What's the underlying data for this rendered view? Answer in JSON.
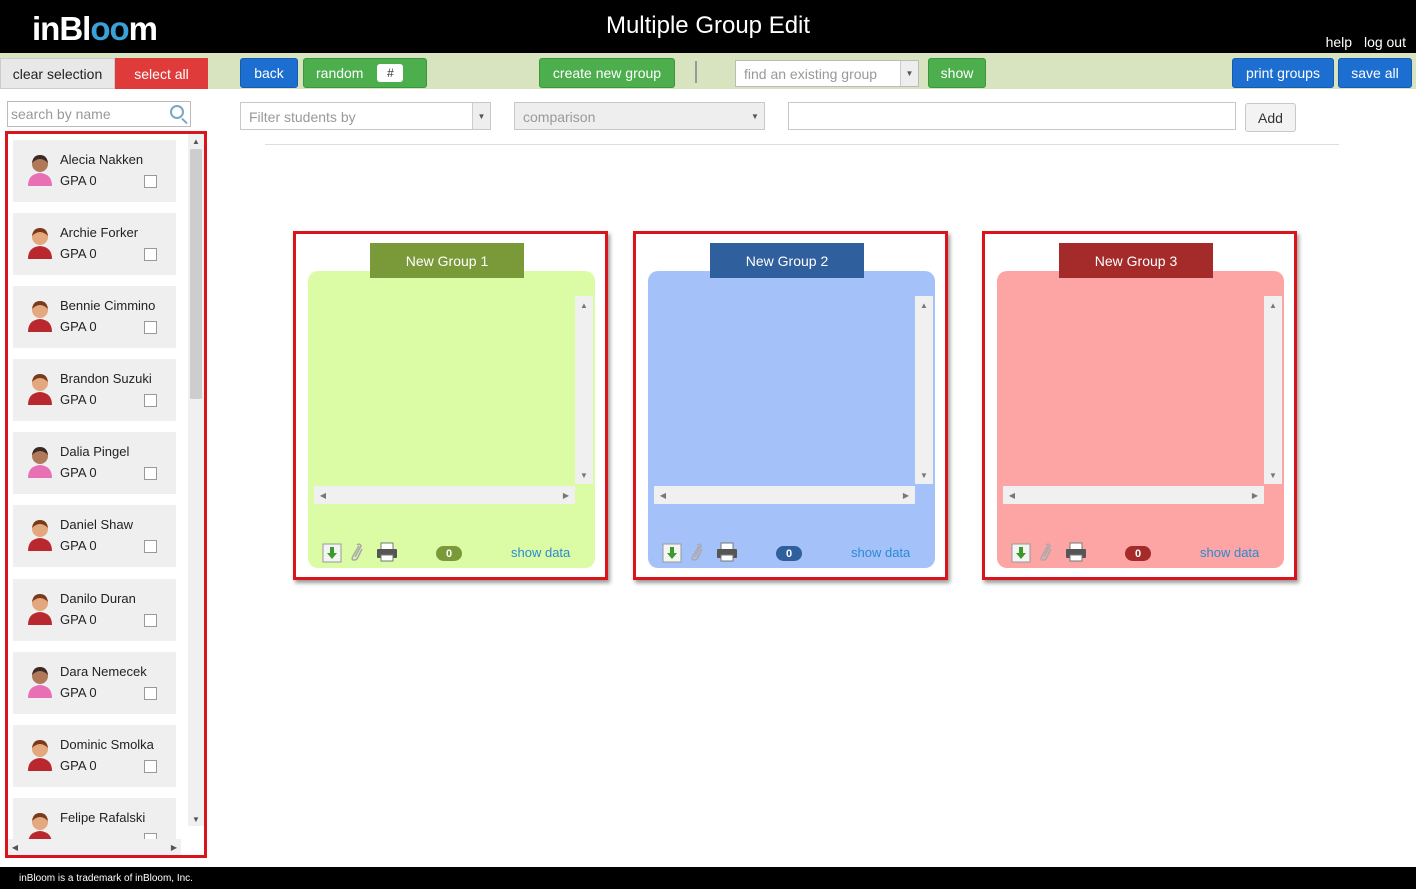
{
  "header": {
    "logo_prefix": "inBl",
    "logo_oo": "oo",
    "logo_suffix": "m",
    "title": "Multiple Group Edit",
    "links": [
      "help",
      "log out"
    ]
  },
  "toolbar": {
    "clear_selection": "clear selection",
    "select_all": "select all",
    "back": "back",
    "random": "random",
    "random_count": "#",
    "create_new_group": "create new group",
    "find_existing_placeholder": "find an existing group",
    "show": "show",
    "print_groups": "print groups",
    "save_all": "save all"
  },
  "sidebar": {
    "search_placeholder": "search by name",
    "students": [
      {
        "name": "Alecia Nakken",
        "gpa": "GPA 0",
        "gender": "female"
      },
      {
        "name": "Archie Forker",
        "gpa": "GPA 0",
        "gender": "male"
      },
      {
        "name": "Bennie Cimmino",
        "gpa": "GPA 0",
        "gender": "male"
      },
      {
        "name": "Brandon Suzuki",
        "gpa": "GPA 0",
        "gender": "male"
      },
      {
        "name": "Dalia Pingel",
        "gpa": "GPA 0",
        "gender": "female"
      },
      {
        "name": "Daniel Shaw",
        "gpa": "GPA 0",
        "gender": "male"
      },
      {
        "name": "Danilo Duran",
        "gpa": "GPA 0",
        "gender": "male"
      },
      {
        "name": "Dara Nemecek",
        "gpa": "GPA 0",
        "gender": "female"
      },
      {
        "name": "Dominic Smolka",
        "gpa": "GPA 0",
        "gender": "male"
      },
      {
        "name": "Felipe Rafalski",
        "gpa": "",
        "gender": "male"
      }
    ]
  },
  "filters": {
    "filter_placeholder": "Filter students by",
    "comparison_placeholder": "comparison",
    "add_label": "Add"
  },
  "groups": [
    {
      "name": "New Group 1",
      "count": "0",
      "show_data": "show data",
      "tab_color": "#7a9a3a",
      "body_color": "#dbfba5",
      "badge_color": "#7a9a3a"
    },
    {
      "name": "New Group 2",
      "count": "0",
      "show_data": "show data",
      "tab_color": "#2f5f9c",
      "body_color": "#a4c2f9",
      "badge_color": "#2f5f9c"
    },
    {
      "name": "New Group 3",
      "count": "0",
      "show_data": "show data",
      "tab_color": "#a52a2a",
      "body_color": "#fda4a4",
      "badge_color": "#a52a2a"
    }
  ],
  "footer": {
    "text": "inBloom is a trademark of inBloom, Inc."
  }
}
